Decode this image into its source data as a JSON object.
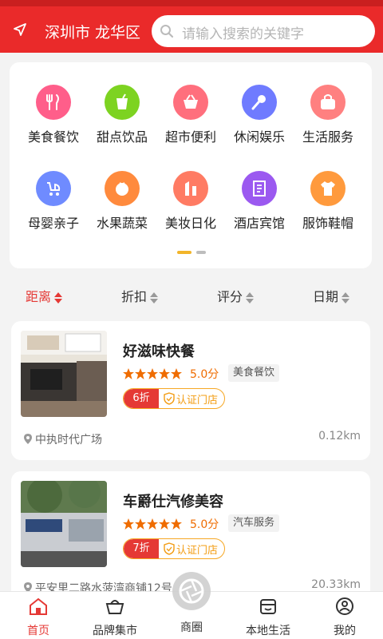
{
  "header": {
    "city": "深圳市 龙华区",
    "search_placeholder": "请输入搜索的关键字"
  },
  "categories": [
    {
      "label": "美食餐饮",
      "icon": "utensils-icon",
      "color": "#ff5e8a"
    },
    {
      "label": "甜点饮品",
      "icon": "drink-cup-icon",
      "color": "#7dd321"
    },
    {
      "label": "超市便利",
      "icon": "basket-icon",
      "color": "#ff6f7d"
    },
    {
      "label": "休闲娱乐",
      "icon": "microphone-icon",
      "color": "#6f7bff"
    },
    {
      "label": "生活服务",
      "icon": "bag-icon",
      "color": "#ff8080"
    },
    {
      "label": "母婴亲子",
      "icon": "stroller-icon",
      "color": "#6f8bff"
    },
    {
      "label": "水果蔬菜",
      "icon": "tomato-icon",
      "color": "#ff8a3d"
    },
    {
      "label": "美妆日化",
      "icon": "lipstick-icon",
      "color": "#ff7b63"
    },
    {
      "label": "酒店宾馆",
      "icon": "hotel-icon",
      "color": "#9b59f0"
    },
    {
      "label": "服饰鞋帽",
      "icon": "shirt-icon",
      "color": "#ff9a3d"
    }
  ],
  "sort": {
    "distance": "距离",
    "discount": "折扣",
    "rating": "评分",
    "date": "日期"
  },
  "shops": [
    {
      "name": "好滋味快餐",
      "score": "5.0分",
      "category": "美食餐饮",
      "discount": "6折",
      "cert": "认证门店",
      "address": "中执时代广场",
      "distance": "0.12km"
    },
    {
      "name": "车爵仕汽修美容",
      "score": "5.0分",
      "category": "汽车服务",
      "discount": "7折",
      "cert": "认证门店",
      "address": "平安里二路水菠湾商铺12号",
      "distance": "20.33km"
    }
  ],
  "tabs": {
    "home": "首页",
    "brand": "品牌集市",
    "circle": "商圈",
    "local": "本地生活",
    "mine": "我的"
  },
  "colors": {
    "brand_red": "#ea2a2a",
    "accent_orange": "#ef6c00"
  }
}
